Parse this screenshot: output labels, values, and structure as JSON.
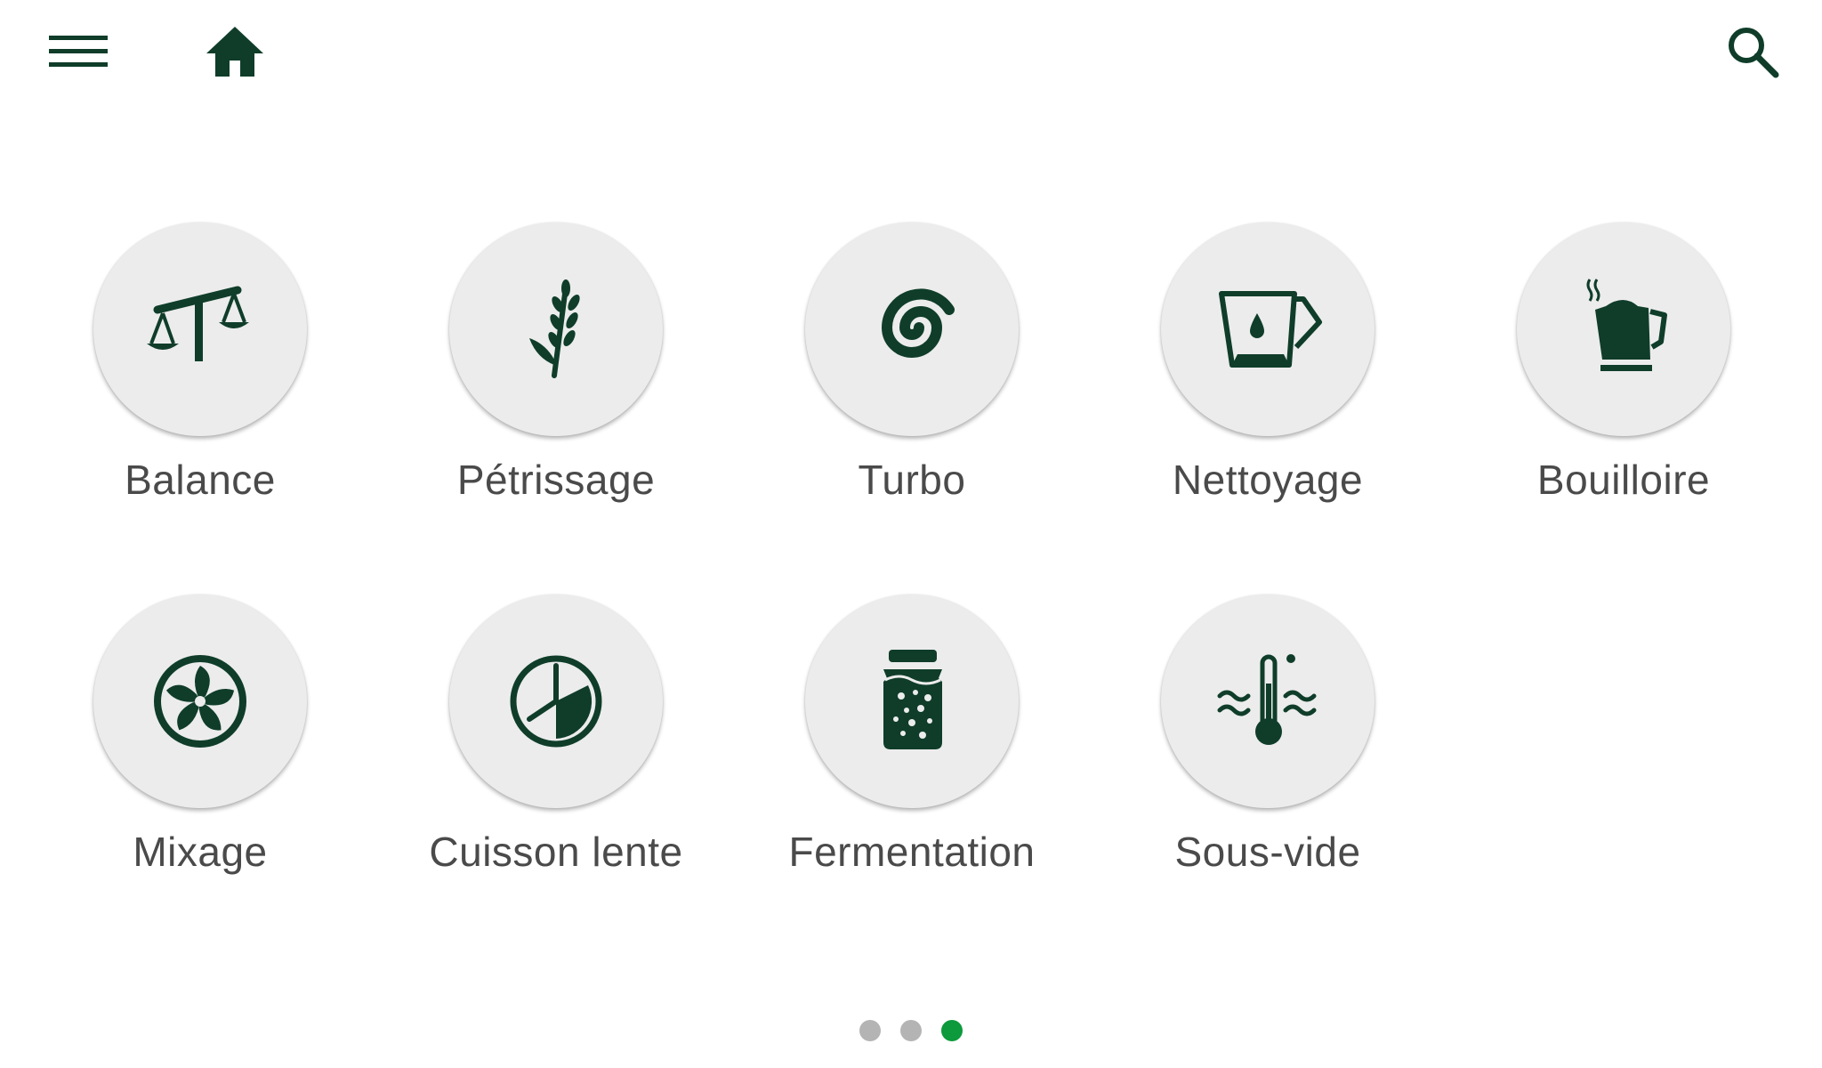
{
  "theme": {
    "icon_color": "#0f3d2a",
    "circle_bg": "#ececec",
    "label_color": "#4a4a4a",
    "dot_inactive": "#b4b4b4",
    "dot_active": "#0c9a3c"
  },
  "header": {
    "menu_icon": "hamburger-menu-icon",
    "home_icon": "home-icon",
    "search_icon": "search-icon"
  },
  "modes": [
    {
      "label": "Balance",
      "icon": "scale-icon"
    },
    {
      "label": "Pétrissage",
      "icon": "wheat-icon"
    },
    {
      "label": "Turbo",
      "icon": "spiral-icon"
    },
    {
      "label": "Nettoyage",
      "icon": "blender-jug-drop-icon"
    },
    {
      "label": "Bouilloire",
      "icon": "kettle-icon"
    },
    {
      "label": "Mixage",
      "icon": "fan-blade-icon"
    },
    {
      "label": "Cuisson lente",
      "icon": "clock-icon"
    },
    {
      "label": "Fermentation",
      "icon": "jar-icon"
    },
    {
      "label": "Sous-vide",
      "icon": "thermometer-water-icon"
    }
  ],
  "pager": {
    "page_count": 3,
    "active_page": 3
  }
}
